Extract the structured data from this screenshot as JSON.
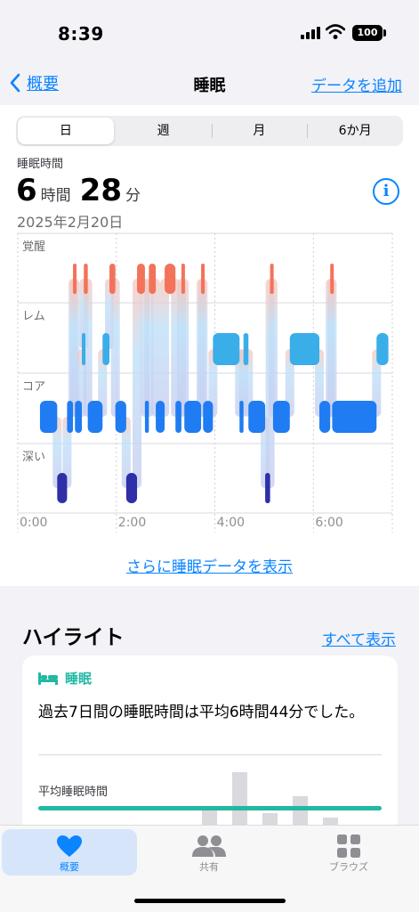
{
  "status": {
    "time": "8:39",
    "battery": "100"
  },
  "nav": {
    "back_label": "概要",
    "title": "睡眠",
    "add_label": "データを追加"
  },
  "segments": [
    "日",
    "週",
    "月",
    "6か月"
  ],
  "summary": {
    "label": "睡眠時間",
    "hours": "6",
    "hours_unit": "時間",
    "minutes": "28",
    "minutes_unit": "分",
    "date": "2025年2月20日"
  },
  "chart_data": {
    "type": "sleep-stages",
    "stages": [
      "覚醒",
      "レム",
      "コア",
      "深い"
    ],
    "x_ticks": [
      "0:00",
      "2:00",
      "4:00",
      "6:00"
    ],
    "x_range_hours": [
      0,
      7.6
    ],
    "colors": {
      "覚醒": "#f2735a",
      "レム": "#3aaee8",
      "コア": "#1f7cf2",
      "深い": "#2f2fa8"
    },
    "segments": [
      {
        "stage": "コア",
        "start": 0.45,
        "end": 0.8
      },
      {
        "stage": "深い",
        "start": 0.8,
        "end": 1.0
      },
      {
        "stage": "コア",
        "start": 1.0,
        "end": 1.12
      },
      {
        "stage": "覚醒",
        "start": 1.12,
        "end": 1.16
      },
      {
        "stage": "コア",
        "start": 1.16,
        "end": 1.3
      },
      {
        "stage": "レム",
        "start": 1.3,
        "end": 1.34
      },
      {
        "stage": "覚醒",
        "start": 1.34,
        "end": 1.42
      },
      {
        "stage": "コア",
        "start": 1.42,
        "end": 1.72
      },
      {
        "stage": "レム",
        "start": 1.72,
        "end": 1.86
      },
      {
        "stage": "覚醒",
        "start": 1.86,
        "end": 1.98
      },
      {
        "stage": "コア",
        "start": 1.98,
        "end": 2.2
      },
      {
        "stage": "深い",
        "start": 2.2,
        "end": 2.42
      },
      {
        "stage": "覚醒",
        "start": 2.42,
        "end": 2.58
      },
      {
        "stage": "コア",
        "start": 2.58,
        "end": 2.66
      },
      {
        "stage": "覚醒",
        "start": 2.66,
        "end": 2.8
      },
      {
        "stage": "コア",
        "start": 2.8,
        "end": 2.98
      },
      {
        "stage": "覚醒",
        "start": 2.98,
        "end": 3.2
      },
      {
        "stage": "コア",
        "start": 3.2,
        "end": 3.32
      },
      {
        "stage": "覚醒",
        "start": 3.32,
        "end": 3.38
      },
      {
        "stage": "コア",
        "start": 3.38,
        "end": 3.72
      },
      {
        "stage": "覚醒",
        "start": 3.72,
        "end": 3.76
      },
      {
        "stage": "コア",
        "start": 3.76,
        "end": 3.96
      },
      {
        "stage": "レム",
        "start": 3.96,
        "end": 4.5
      },
      {
        "stage": "コア",
        "start": 4.5,
        "end": 4.58
      },
      {
        "stage": "レム",
        "start": 4.58,
        "end": 4.68
      },
      {
        "stage": "コア",
        "start": 4.68,
        "end": 5.02
      },
      {
        "stage": "深い",
        "start": 5.02,
        "end": 5.12
      },
      {
        "stage": "覚醒",
        "start": 5.12,
        "end": 5.18
      },
      {
        "stage": "コア",
        "start": 5.18,
        "end": 5.52
      },
      {
        "stage": "レム",
        "start": 5.52,
        "end": 6.12
      },
      {
        "stage": "コア",
        "start": 6.12,
        "end": 6.34
      },
      {
        "stage": "覚醒",
        "start": 6.34,
        "end": 6.38
      },
      {
        "stage": "コア",
        "start": 6.38,
        "end": 7.28
      },
      {
        "stage": "レム",
        "start": 7.28,
        "end": 7.52
      }
    ]
  },
  "more_link": "さらに睡眠データを表示",
  "highlights": {
    "title": "ハイライト",
    "show_all": "すべて表示",
    "card": {
      "category": "睡眠",
      "text": "過去7日間の睡眠時間は平均6時間44分でした。",
      "sub_label": "平均睡眠時間"
    }
  },
  "tabbar": [
    {
      "label": "概要",
      "icon": "heart-icon"
    },
    {
      "label": "共有",
      "icon": "people-icon"
    },
    {
      "label": "ブラウズ",
      "icon": "grid-icon"
    }
  ]
}
